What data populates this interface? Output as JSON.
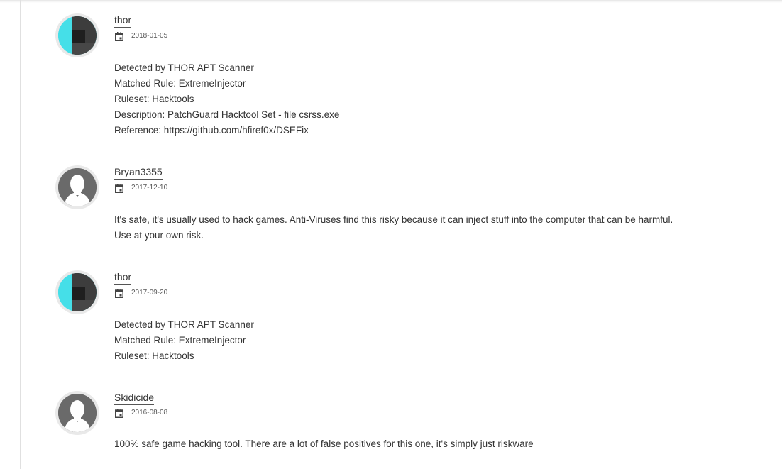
{
  "colors": {
    "thor_avatar_cyan": "#45dfe8",
    "thor_avatar_dark": "#3d3d3d",
    "default_avatar_bg": "#6a6a6a",
    "default_avatar_silhouette": "#ffffff"
  },
  "comments": [
    {
      "author": "thor",
      "date": "2018-01-05",
      "avatar": "thor-logo-avatar",
      "lines": [
        "Detected by THOR APT Scanner",
        "Matched Rule: ExtremeInjector",
        "Ruleset: Hacktools",
        "Description: PatchGuard Hacktool Set - file csrss.exe",
        "Reference: https://github.com/hfiref0x/DSEFix"
      ]
    },
    {
      "author": "Bryan3355",
      "date": "2017-12-10",
      "avatar": "default-user-avatar",
      "lines": [
        "It's safe, it's usually used to hack games. Anti-Viruses find this risky because it can inject stuff into the computer that can be harmful.",
        "Use at your own risk."
      ]
    },
    {
      "author": "thor",
      "date": "2017-09-20",
      "avatar": "thor-logo-avatar",
      "lines": [
        "Detected by THOR APT Scanner",
        "Matched Rule: ExtremeInjector",
        "Ruleset: Hacktools"
      ]
    },
    {
      "author": "Skidicide",
      "date": "2016-08-08",
      "avatar": "default-user-avatar",
      "lines": [
        "100% safe game hacking tool. There are a lot of false positives for this one, it's simply just riskware"
      ]
    }
  ],
  "icons": {
    "date": "calendar-icon"
  }
}
